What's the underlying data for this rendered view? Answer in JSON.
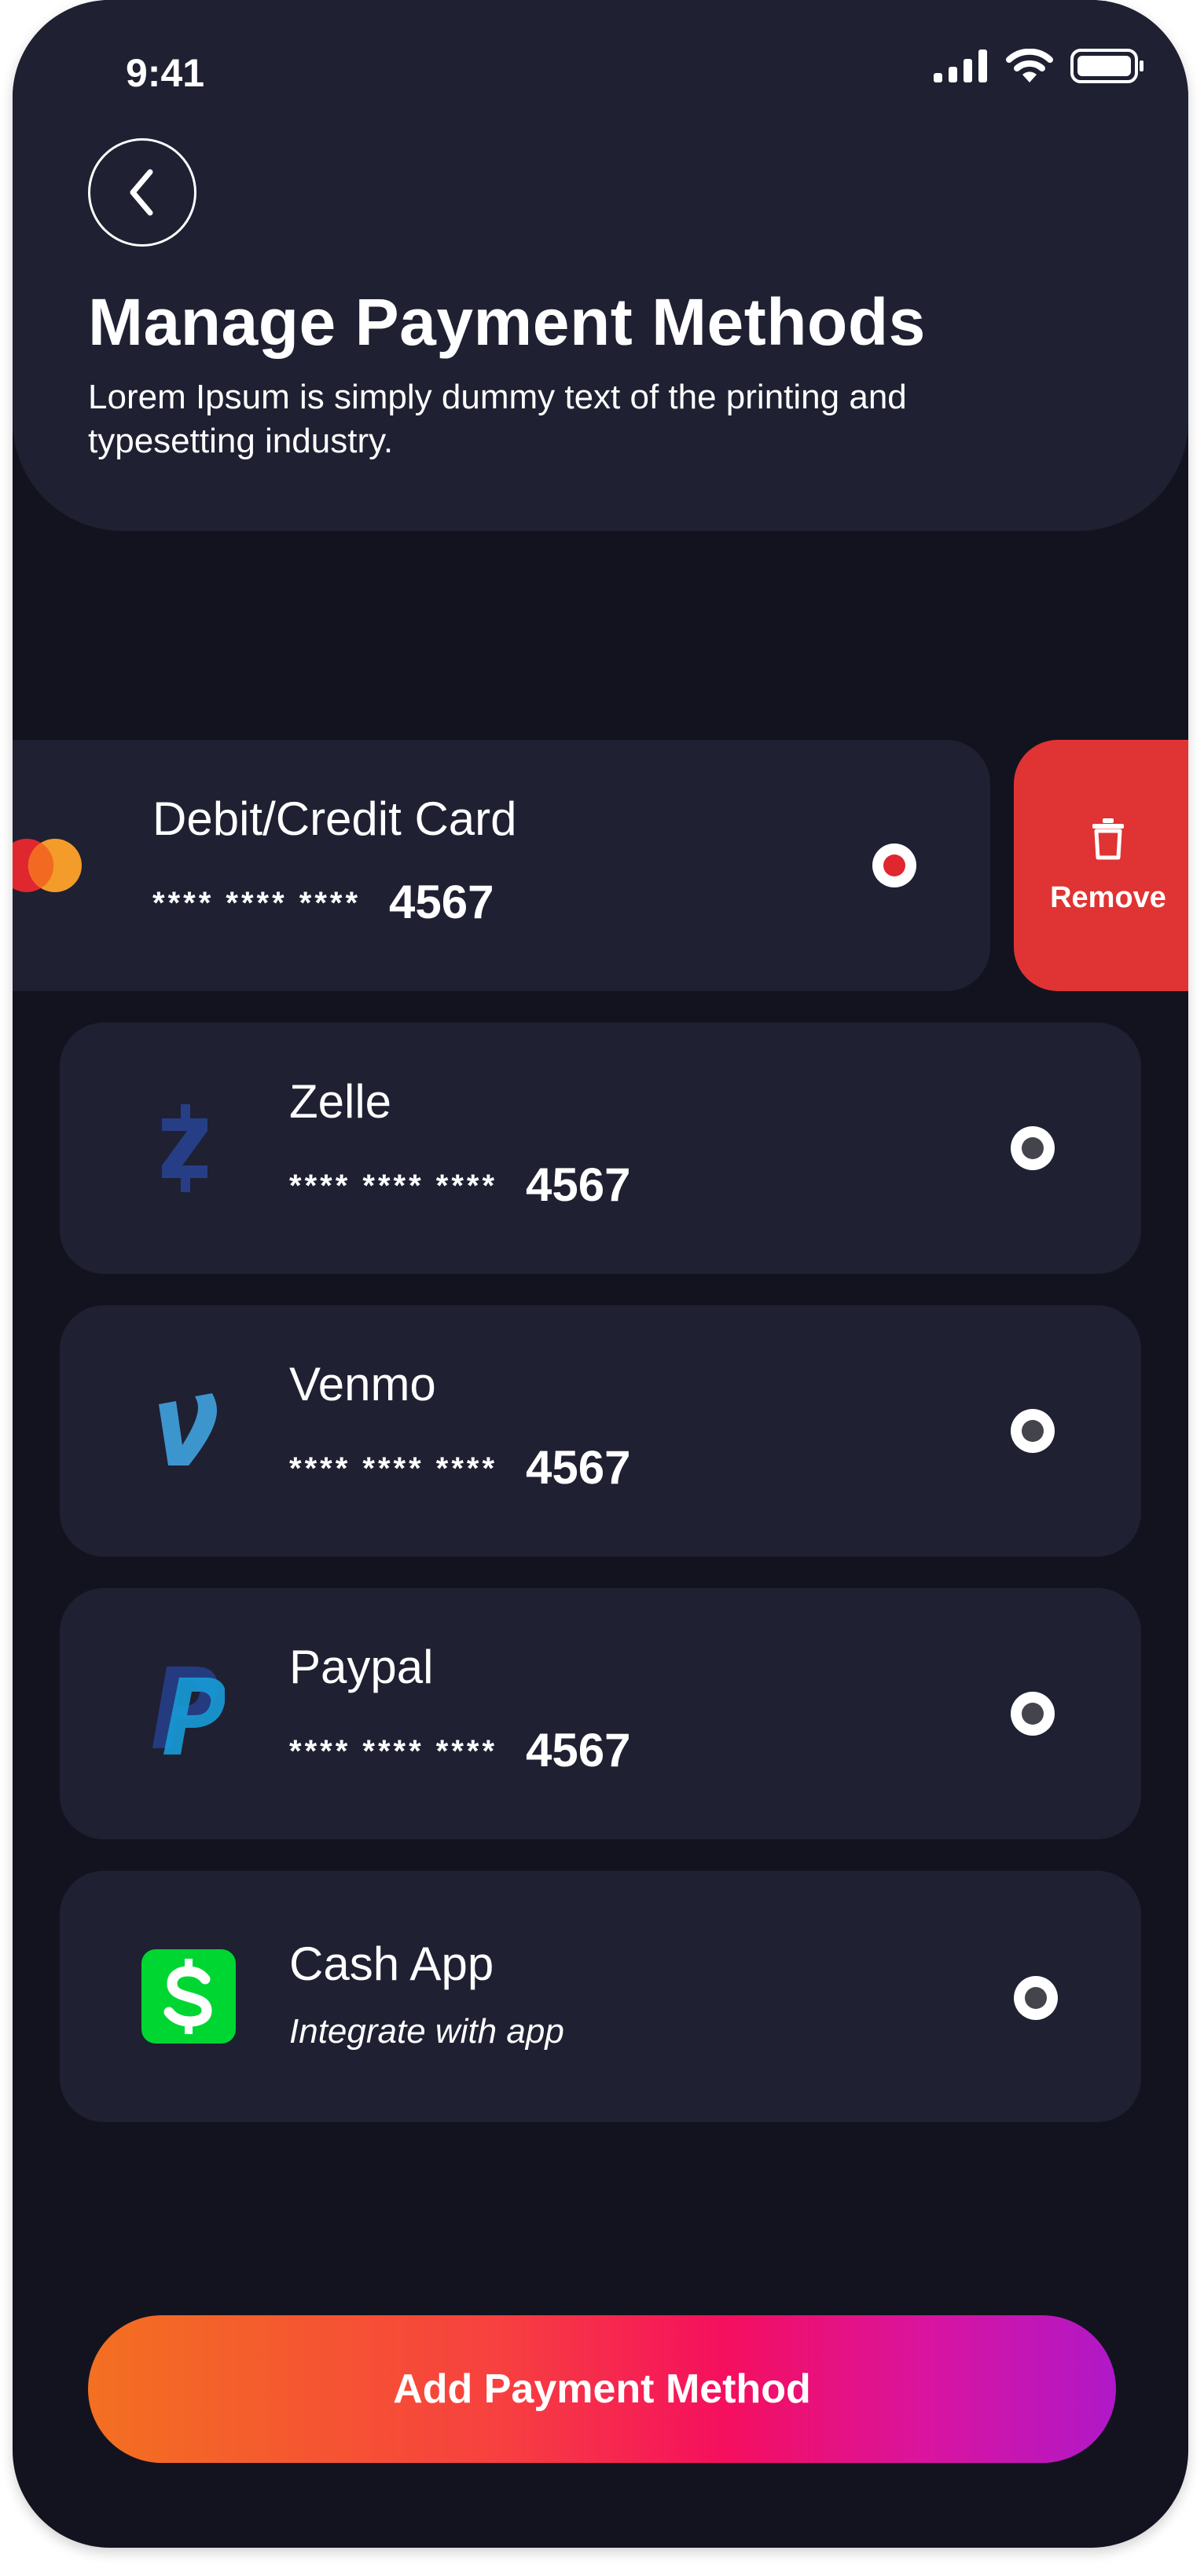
{
  "status_bar": {
    "time": "9:41",
    "signal_icon": "cellular-signal-icon",
    "wifi_icon": "wifi-icon",
    "battery_icon": "battery-icon"
  },
  "header": {
    "back_icon": "chevron-left-icon",
    "title": "Manage Payment Methods",
    "subtitle": "Lorem Ipsum is simply dummy text of the printing and typesetting industry."
  },
  "payment_methods": [
    {
      "name": "Debit/Credit Card",
      "mask": "**** **** ****",
      "last4": "4567",
      "logo": "mastercard-logo-icon",
      "selected": true
    },
    {
      "name": "Zelle",
      "mask": "**** **** ****",
      "last4": "4567",
      "logo": "zelle-logo-icon",
      "selected": false
    },
    {
      "name": "Venmo",
      "mask": "**** **** ****",
      "last4": "4567",
      "logo": "venmo-logo-icon",
      "selected": false
    },
    {
      "name": "Paypal",
      "mask": "**** **** ****",
      "last4": "4567",
      "logo": "paypal-logo-icon",
      "selected": false
    },
    {
      "name": "Cash App",
      "subtext": "Integrate with app",
      "logo": "cash-app-logo-icon",
      "selected": false
    }
  ],
  "remove_action": {
    "label": "Remove",
    "icon": "trash-icon"
  },
  "add_button": {
    "label": "Add Payment Method"
  },
  "colors": {
    "background": "#13131f",
    "card": "#1f2032",
    "remove": "#e03333",
    "gradient_start": "#f37021",
    "gradient_mid": "#f50f5e",
    "gradient_end": "#b018c8",
    "selected_dot": "#e0262f"
  }
}
